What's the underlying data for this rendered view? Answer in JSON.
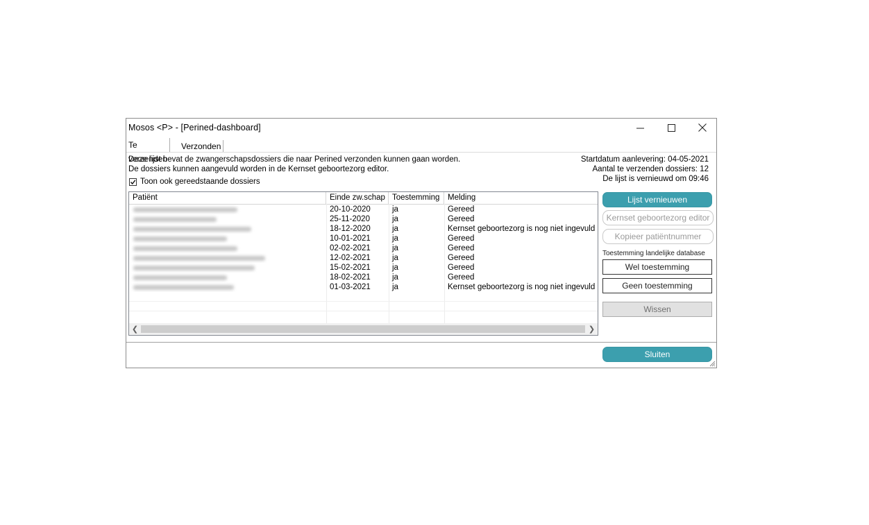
{
  "window": {
    "title": "Mosos <P> - [Perined-dashboard]"
  },
  "tabs": [
    "Te verzenden",
    "Verzonden"
  ],
  "info": {
    "line1": "Deze lijst bevat de zwangerschapsdossiers die naar Perined verzonden kunnen gaan worden.",
    "line2": "De dossiers kunnen aangevuld worden in de Kernset geboortezorg editor.",
    "startdatum": "Startdatum aanlevering: 04-05-2021",
    "aantal": "Aantal te verzenden dossiers: 12",
    "vernieuwd": "De lijst is vernieuwd om 09:46"
  },
  "checkbox": {
    "label": "Toon ook gereedstaande dossiers",
    "checked": true
  },
  "table": {
    "columns": [
      "Patiënt",
      "Einde zw.schap",
      "Toestemming",
      "Melding"
    ],
    "rows": [
      {
        "einde": "20-10-2020",
        "toestemming": "ja",
        "melding": "Gereed"
      },
      {
        "einde": "25-11-2020",
        "toestemming": "ja",
        "melding": "Gereed"
      },
      {
        "einde": "18-12-2020",
        "toestemming": "ja",
        "melding": "Kernset geboortezorg is nog niet ingevuld"
      },
      {
        "einde": "10-01-2021",
        "toestemming": "ja",
        "melding": "Gereed"
      },
      {
        "einde": "02-02-2021",
        "toestemming": "ja",
        "melding": "Gereed"
      },
      {
        "einde": "12-02-2021",
        "toestemming": "ja",
        "melding": "Gereed"
      },
      {
        "einde": "15-02-2021",
        "toestemming": "ja",
        "melding": "Gereed"
      },
      {
        "einde": "18-02-2021",
        "toestemming": "ja",
        "melding": "Gereed"
      },
      {
        "einde": "01-03-2021",
        "toestemming": "ja",
        "melding": "Kernset geboortezorg is nog niet ingevuld"
      }
    ]
  },
  "buttons": {
    "lijst_vernieuwen": "Lijst vernieuwen",
    "kernset_editor": "Kernset geboortezorg editor",
    "kopieer": "Kopieer patiëntnummer",
    "toestemming_label": "Toestemming landelijke database",
    "wel": "Wel toestemming",
    "geen": "Geen toestemming",
    "wissen": "Wissen",
    "sluiten": "Sluiten"
  },
  "colors": {
    "accent": "#3c9fae"
  }
}
